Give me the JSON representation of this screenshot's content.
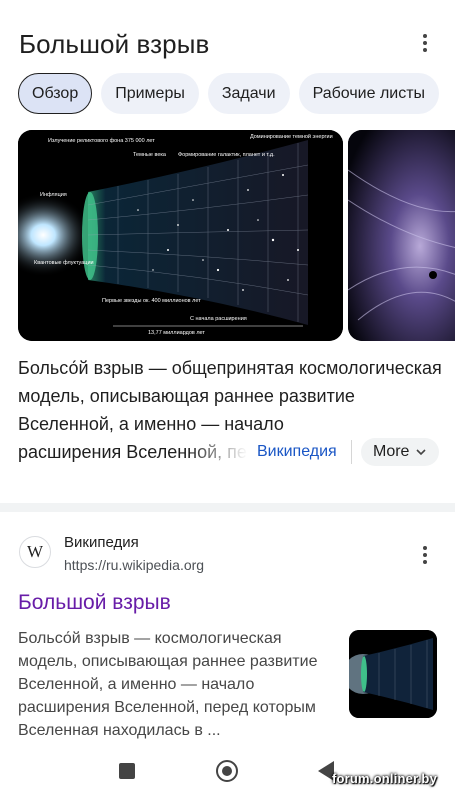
{
  "panel": {
    "title": "Большой взрыв"
  },
  "chips": [
    {
      "label": "Обзор",
      "active": true
    },
    {
      "label": "Примеры",
      "active": false
    },
    {
      "label": "Задачи",
      "active": false
    },
    {
      "label": "Рабочие листы",
      "active": false
    }
  ],
  "image_labels": {
    "top_left": "Излучение реликтового фона 375 000 лет",
    "dark_ages": "Темные века",
    "formation": "Формирование галактик, планет и т.д.",
    "dark_energy": "Доминирование темной энергии",
    "inflation": "Инфляция",
    "quantum": "Квантовые флуктуации",
    "first_stars": "Первые звезды ок. 400 миллионов лет",
    "expansion": "С начала расширения",
    "age": "13,77 миллиардов лет"
  },
  "description": {
    "text": "Больсо́й взрыв — общепринятая космологическая модель, описывающая раннее развитие Вселенной, а именно — начало",
    "last_line": "расширения Вселенной, пе",
    "source_link": "Википедия",
    "more_label": "More"
  },
  "result": {
    "site_name": "Википедия",
    "site_url": "https://ru.wikipedia.org",
    "favicon_letter": "W",
    "title": "Большой взрыв",
    "snippet": "Больсо́й взрыв — космологическая модель, описывающая раннее развитие Вселенной, а именно — начало расширения Вселенной, перед которым Вселенная находилась в ..."
  },
  "watermark": "forum.onliner.by",
  "colors": {
    "link_blue": "#1a56c5",
    "visited_purple": "#681da8",
    "chip_bg": "#eef1f8"
  }
}
